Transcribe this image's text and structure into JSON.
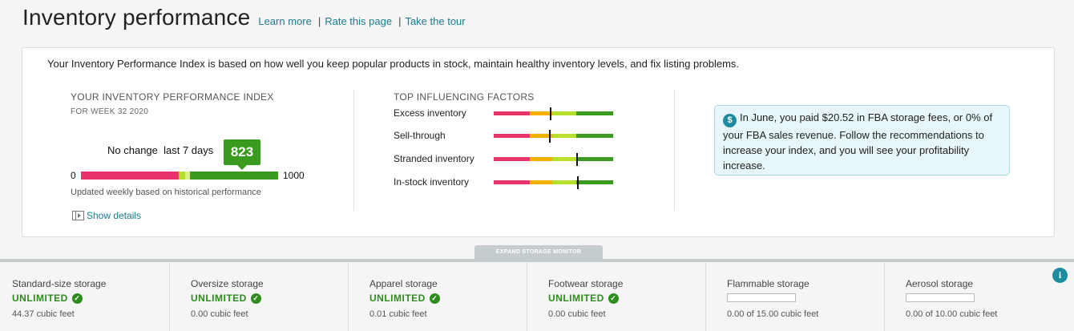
{
  "header": {
    "title": "Inventory performance",
    "links": [
      "Learn more",
      "Rate this page",
      "Take the tour"
    ]
  },
  "card": {
    "intro": "Your Inventory Performance Index is based on how well you keep popular products in stock, maintain healthy inventory levels, and fix listing problems.",
    "ipi": {
      "title": "YOUR INVENTORY PERFORMANCE INDEX",
      "week": "FOR WEEK 32 2020",
      "change_text": "No change  last 7 days",
      "score": "823",
      "scale_min": "0",
      "scale_max": "1000",
      "updated_note": "Updated weekly based on historical performance",
      "show_details": "Show details"
    },
    "factors": {
      "title": "TOP INFLUENCING FACTORS",
      "items": [
        {
          "label": "Excess inventory",
          "level": 0.47
        },
        {
          "label": "Sell-through",
          "level": 0.46
        },
        {
          "label": "Stranded inventory",
          "level": 0.69
        },
        {
          "label": "In-stock inventory",
          "level": 0.7
        }
      ]
    },
    "info_message": "In June, you paid $20.52 in FBA storage fees, or 0% of your FBA sales revenue. Follow the recommendations to increase your index, and you will see your profitability increase."
  },
  "storage_monitor": {
    "expand_label": "EXPAND STORAGE MONITOR",
    "columns": [
      {
        "label": "Standard-size storage",
        "status": "UNLIMITED",
        "value": "44.37 cubic feet"
      },
      {
        "label": "Oversize storage",
        "status": "UNLIMITED",
        "value": "0.00 cubic feet"
      },
      {
        "label": "Apparel storage",
        "status": "UNLIMITED",
        "value": "0.01 cubic feet"
      },
      {
        "label": "Footwear storage",
        "status": "UNLIMITED",
        "value": "0.00 cubic feet"
      },
      {
        "label": "Flammable storage",
        "status": "",
        "value": "0.00 of 15.00 cubic feet"
      },
      {
        "label": "Aerosol storage",
        "status": "",
        "value": "0.00 of 10.00 cubic feet"
      }
    ]
  },
  "colors": {
    "link": "#1a7c8e",
    "good": "#3a9b1f",
    "bad": "#e8346a",
    "warn": "#f5b000",
    "fair": "#b7e02c"
  },
  "icons": [
    "dollar-icon",
    "check-icon",
    "info-icon",
    "panel-icon"
  ]
}
